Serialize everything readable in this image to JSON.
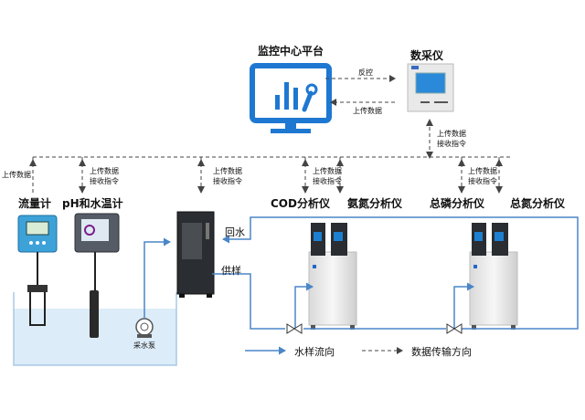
{
  "nodes": {
    "monitor_platform": "监控中心平台",
    "data_collector": "数采仪",
    "flow_meter": "流量计",
    "ph_meter": "pH和水温计",
    "cod_analyzer": "COD分析仪",
    "ammonia_analyzer": "氨氮分析仪",
    "tp_analyzer": "总磷分析仪",
    "tn_analyzer": "总氮分析仪",
    "pump": "采水泵"
  },
  "links": {
    "reverse_control": "反控",
    "upload": "上传数据",
    "upload_receive_1": "上传数据",
    "upload_receive_2": "接收指令",
    "return_water": "回水",
    "supply_sample": "供样"
  },
  "legend": {
    "water_flow": "水样流向",
    "data_flow": "数据传输方向"
  },
  "colors": {
    "water_line": "#4a86c8",
    "data_line": "#444444",
    "icon_blue": "#1e78d2",
    "water": "#dcecf8"
  }
}
